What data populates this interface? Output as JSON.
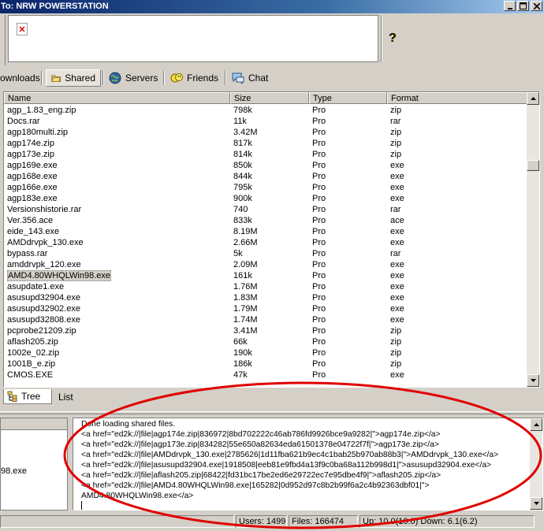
{
  "window": {
    "title": "To: NRW POWERSTATION"
  },
  "tabs": [
    {
      "label": "ownloads"
    },
    {
      "label": "Shared"
    },
    {
      "label": "Servers"
    },
    {
      "label": "Friends"
    },
    {
      "label": "Chat"
    }
  ],
  "columns": [
    "Name",
    "Size",
    "Type",
    "Format"
  ],
  "files": [
    {
      "name": "agp_1.83_eng.zip",
      "size": "798k",
      "type": "Pro",
      "format": "zip"
    },
    {
      "name": "Docs.rar",
      "size": "11k",
      "type": "Pro",
      "format": "rar"
    },
    {
      "name": "agp180multi.zip",
      "size": "3.42M",
      "type": "Pro",
      "format": "zip"
    },
    {
      "name": "agp174e.zip",
      "size": "817k",
      "type": "Pro",
      "format": "zip"
    },
    {
      "name": "agp173e.zip",
      "size": "814k",
      "type": "Pro",
      "format": "zip"
    },
    {
      "name": "agp169e.exe",
      "size": "850k",
      "type": "Pro",
      "format": "exe"
    },
    {
      "name": "agp168e.exe",
      "size": "844k",
      "type": "Pro",
      "format": "exe"
    },
    {
      "name": "agp166e.exe",
      "size": "795k",
      "type": "Pro",
      "format": "exe"
    },
    {
      "name": "agp183e.exe",
      "size": "900k",
      "type": "Pro",
      "format": "exe"
    },
    {
      "name": "Versionshistorie.rar",
      "size": "740",
      "type": "Pro",
      "format": "rar"
    },
    {
      "name": "Ver.356.ace",
      "size": "833k",
      "type": "Pro",
      "format": "ace"
    },
    {
      "name": "eide_143.exe",
      "size": "8.19M",
      "type": "Pro",
      "format": "exe"
    },
    {
      "name": "AMDdrvpk_130.exe",
      "size": "2.66M",
      "type": "Pro",
      "format": "exe"
    },
    {
      "name": "bypass.rar",
      "size": "5k",
      "type": "Pro",
      "format": "rar"
    },
    {
      "name": "amddrvpk_120.exe",
      "size": "2.09M",
      "type": "Pro",
      "format": "exe"
    },
    {
      "name": "AMD4.80WHQLWin98.exe",
      "size": "161k",
      "type": "Pro",
      "format": "exe"
    },
    {
      "name": "asupdate1.exe",
      "size": "1.76M",
      "type": "Pro",
      "format": "exe"
    },
    {
      "name": "asusupd32904.exe",
      "size": "1.83M",
      "type": "Pro",
      "format": "exe"
    },
    {
      "name": "asusupd32902.exe",
      "size": "1.79M",
      "type": "Pro",
      "format": "exe"
    },
    {
      "name": "asusupd32808.exe",
      "size": "1.74M",
      "type": "Pro",
      "format": "exe"
    },
    {
      "name": "pcprobe21209.zip",
      "size": "3.41M",
      "type": "Pro",
      "format": "zip"
    },
    {
      "name": "aflash205.zip",
      "size": "66k",
      "type": "Pro",
      "format": "zip"
    },
    {
      "name": "1002e_02.zip",
      "size": "190k",
      "type": "Pro",
      "format": "zip"
    },
    {
      "name": "1001B_e.zip",
      "size": "186k",
      "type": "Pro",
      "format": "zip"
    },
    {
      "name": "CMOS.EXE",
      "size": "47k",
      "type": "Pro",
      "format": "exe"
    }
  ],
  "selected_row": 15,
  "bottom_tabs": [
    {
      "label": "Tree"
    },
    {
      "label": "List"
    }
  ],
  "left_pane_text": "98.exe",
  "console_lines": [
    "Done loading shared files.",
    "<a href=\"ed2k://|file|agp174e.zip|836972|8bd702222c46ab786fd9926bce9a9282|\">agp174e.zip</a>",
    "<a href=\"ed2k://|file|agp173e.zip|834282|55e650a82634eda61501378e04722f7f|\">agp173e.zip</a>",
    "<a href=\"ed2k://|file|AMDdrvpk_130.exe|2785626|1d11fba621b9ec4c1bab25b970ab88b3|\">AMDdrvpk_130.exe</a>",
    "<a href=\"ed2k://|file|asusupd32904.exe|1918508|eeb81e9fbd4a13f9c0ba68a112b998d1|\">asusupd32904.exe</a>",
    "<a href=\"ed2k://|file|aflash205.zip|68422|fd31bc17be2ed6e29722ec7e95dbe4f9|\">aflash205.zip</a>",
    "<a href=\"ed2k://|file|AMD4.80WHQLWin98.exe|165282|0d952d97c8b2b99f6a2c4b92363dbf01|\">",
    "AMD4.80WHQLWin98.exe</a>"
  ],
  "status": {
    "users": "Users: 1499",
    "files": "Files: 166474",
    "speed": "Up: 10.0(10.0) Down: 6.1(6.2)"
  },
  "colors": {
    "annotation": "#e00000",
    "title_start": "#0a246a",
    "title_end": "#a6caf0"
  }
}
